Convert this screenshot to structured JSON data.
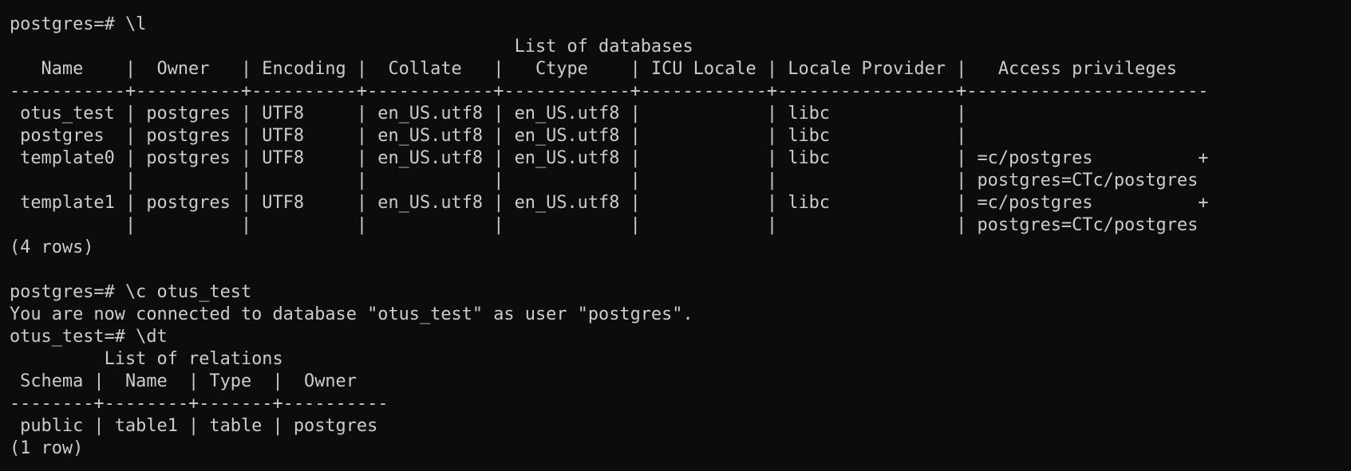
{
  "terminal": {
    "background": "#0c0c0c",
    "foreground": "#cccccc",
    "lines": [
      "postgres=# \\l",
      "                                                List of databases",
      "   Name    |  Owner   | Encoding |  Collate   |   Ctype    | ICU Locale | Locale Provider |   Access privileges",
      "-----------+----------+----------+------------+------------+------------+-----------------+-----------------------",
      " otus_test | postgres | UTF8     | en_US.utf8 | en_US.utf8 |            | libc            |",
      " postgres  | postgres | UTF8     | en_US.utf8 | en_US.utf8 |            | libc            |",
      " template0 | postgres | UTF8     | en_US.utf8 | en_US.utf8 |            | libc            | =c/postgres          +",
      "           |          |          |            |            |            |                 | postgres=CTc/postgres",
      " template1 | postgres | UTF8     | en_US.utf8 | en_US.utf8 |            | libc            | =c/postgres          +",
      "           |          |          |            |            |            |                 | postgres=CTc/postgres",
      "(4 rows)",
      "",
      "postgres=# \\c otus_test",
      "You are now connected to database \"otus_test\" as user \"postgres\".",
      "otus_test=# \\dt",
      "         List of relations",
      " Schema |  Name  | Type  |  Owner",
      "--------+--------+-------+----------",
      " public | table1 | table | postgres",
      "(1 row)"
    ]
  }
}
